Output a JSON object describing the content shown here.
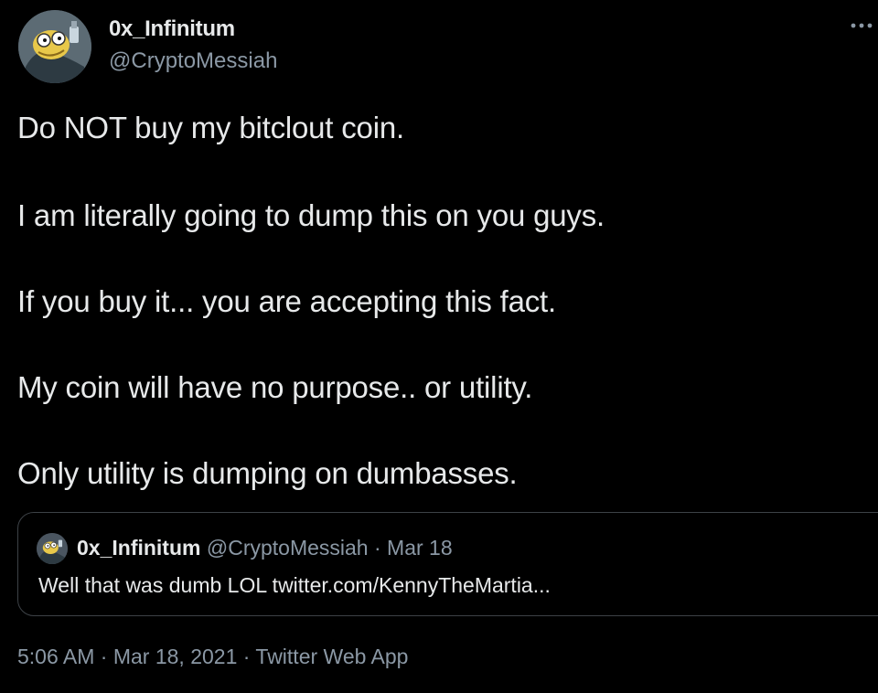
{
  "author": {
    "display_name": "0x_Infinitum",
    "handle": "@CryptoMessiah",
    "avatar_icon": "cartoon-character-avatar-icon"
  },
  "menu_icon": "more-dots-icon",
  "tweet": {
    "lines": [
      "Do NOT buy my bitclout coin.",
      "I am literally going to dump this on you guys.",
      "If you buy it... you are accepting this fact.",
      "My coin will have no purpose.. or utility.",
      "Only utility is dumping on dumbasses."
    ]
  },
  "quoted_tweet": {
    "display_name": "0x_Infinitum",
    "handle": "@CryptoMessiah",
    "separator": "·",
    "date": "Mar 18",
    "text": "Well that was dumb LOL twitter.com/KennyTheMartia..."
  },
  "meta": {
    "time": "5:06 AM",
    "sep1": "·",
    "date": "Mar 18, 2021",
    "sep2": "·",
    "source": "Twitter Web App"
  },
  "colors": {
    "background": "#000000",
    "text_primary": "#e7e9ea",
    "text_secondary": "#8b98a5",
    "border": "#3d4247"
  }
}
